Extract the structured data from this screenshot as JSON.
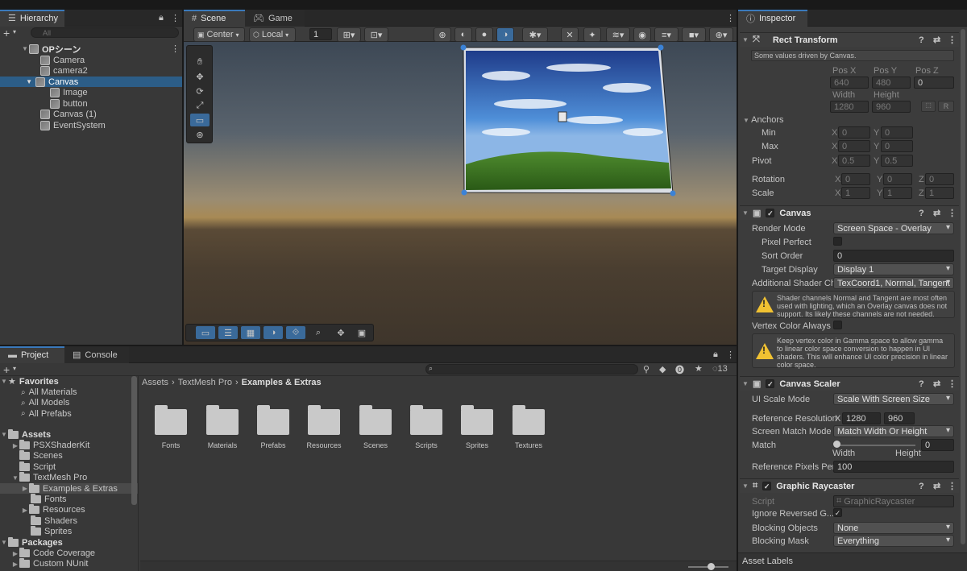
{
  "hierarchy": {
    "tab_label": "Hierarchy",
    "search_placeholder": "All",
    "scene_name": "OPシーン",
    "items": [
      "Camera",
      "camera2",
      "Canvas",
      "Image",
      "button",
      "Canvas (1)",
      "EventSystem"
    ]
  },
  "scene_view": {
    "tabs": [
      "Scene",
      "Game"
    ],
    "pivot_mode": "Center",
    "pivot_space": "Local",
    "grid_value": "1"
  },
  "project": {
    "tabs": [
      "Project",
      "Console"
    ],
    "favorites_label": "Favorites",
    "favorites": [
      "All Materials",
      "All Models",
      "All Prefabs"
    ],
    "assets_label": "Assets",
    "assets_tree": [
      "PSXShaderKit",
      "Scenes",
      "Script",
      "TextMesh Pro",
      "Examples & Extras",
      "Fonts",
      "Resources",
      "Shaders",
      "Sprites"
    ],
    "packages_label": "Packages",
    "packages": [
      "Code Coverage",
      "Custom NUnit"
    ],
    "breadcrumb": [
      "Assets",
      "TextMesh Pro",
      "Examples & Extras"
    ],
    "hidden_count": "13",
    "folders": [
      "Fonts",
      "Materials",
      "Prefabs",
      "Resources",
      "Scenes",
      "Scripts",
      "Sprites",
      "Textures"
    ]
  },
  "inspector": {
    "tab_label": "Inspector",
    "rect_transform": {
      "title": "Rect Transform",
      "note": "Some values driven by Canvas.",
      "pos_x_label": "Pos X",
      "pos_y_label": "Pos Y",
      "pos_z_label": "Pos Z",
      "pos_x": "640",
      "pos_y": "480",
      "pos_z": "0",
      "width_label": "Width",
      "height_label": "Height",
      "width": "1280",
      "height": "960",
      "r_label": "R",
      "anchors_label": "Anchors",
      "min_label": "Min",
      "max_label": "Max",
      "min_x": "0",
      "min_y": "0",
      "max_x": "0",
      "max_y": "0",
      "pivot_label": "Pivot",
      "pivot_x": "0.5",
      "pivot_y": "0.5",
      "rotation_label": "Rotation",
      "rot_x": "0",
      "rot_y": "0",
      "rot_z": "0",
      "scale_label": "Scale",
      "scale_x": "1",
      "scale_y": "1",
      "scale_z": "1",
      "x": "X",
      "y": "Y",
      "z": "Z"
    },
    "canvas": {
      "title": "Canvas",
      "render_mode_label": "Render Mode",
      "render_mode": "Screen Space - Overlay",
      "pixel_perfect_label": "Pixel Perfect",
      "sort_order_label": "Sort Order",
      "sort_order": "0",
      "target_display_label": "Target Display",
      "target_display": "Display 1",
      "shader_channels_label": "Additional Shader Ch",
      "shader_channels": "TexCoord1, Normal, Tangent",
      "warning1": "Shader channels Normal and Tangent are most often used with lighting, which an Overlay canvas does not support. Its likely these channels are not needed.",
      "vertex_color_label": "Vertex Color Always",
      "warning2": "Keep vertex color in Gamma space to allow gamma to linear color space conversion to happen in UI shaders. This will enhance UI color precision in linear color space."
    },
    "canvas_scaler": {
      "title": "Canvas Scaler",
      "ui_scale_mode_label": "UI Scale Mode",
      "ui_scale_mode": "Scale With Screen Size",
      "ref_res_label": "Reference Resolution",
      "ref_x": "1280",
      "ref_y": "960",
      "match_mode_label": "Screen Match Mode",
      "match_mode": "Match Width Or Height",
      "match_label": "Match",
      "match_value": "0",
      "width_label": "Width",
      "height_label": "Height",
      "ref_ppu_label": "Reference Pixels Per",
      "ref_ppu": "100"
    },
    "graphic_raycaster": {
      "title": "Graphic Raycaster",
      "script_label": "Script",
      "script_value": "GraphicRaycaster",
      "ignore_reversed_label": "Ignore Reversed G...",
      "blocking_objects_label": "Blocking Objects",
      "blocking_objects": "None",
      "blocking_mask_label": "Blocking Mask",
      "blocking_mask": "Everything"
    },
    "asset_labels": "Asset Labels"
  }
}
